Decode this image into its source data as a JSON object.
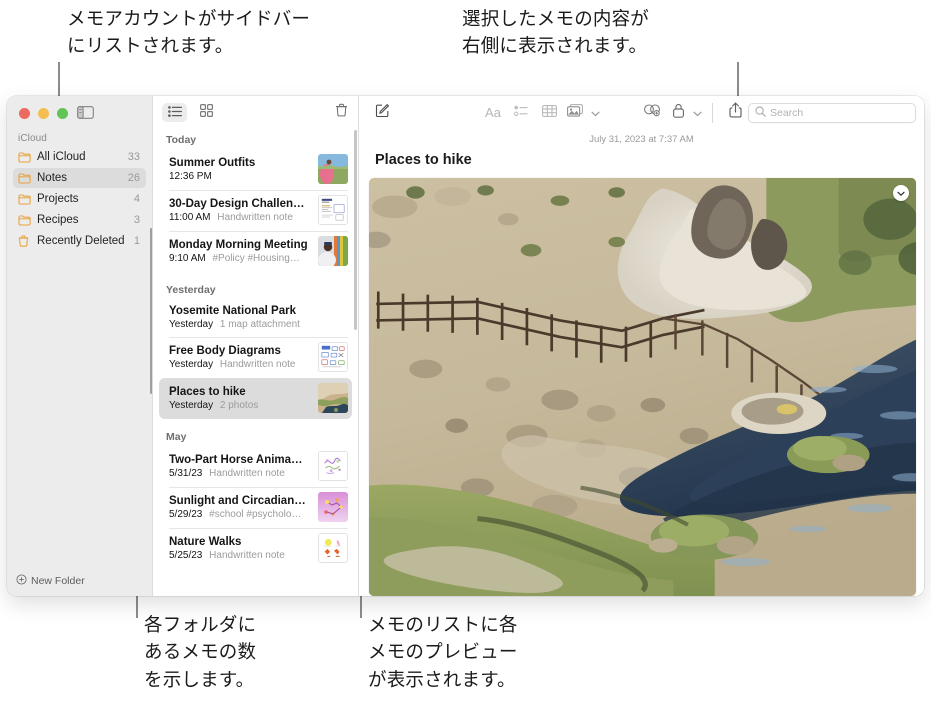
{
  "annotations": [
    {
      "id": "a1",
      "text": "メモアカウントがサイドバー\nにリストされます。"
    },
    {
      "id": "a2",
      "text": "選択したメモの内容が\n右側に表示されます。"
    },
    {
      "id": "a3",
      "text": "各フォルダに\nあるメモの数\nを示します。"
    },
    {
      "id": "a4",
      "text": "メモのリストに各\nメモのプレビュー\nが表示されます。"
    }
  ],
  "window": {
    "traffic_lights": [
      "close-red",
      "minimize-yellow",
      "zoom-green"
    ],
    "sidebar_toggle_icon": "sidebar-toggle-icon"
  },
  "sidebar": {
    "section_label": "iCloud",
    "items": [
      {
        "label": "All iCloud",
        "count": "33",
        "icon": "folder-icon",
        "selected": false
      },
      {
        "label": "Notes",
        "count": "26",
        "icon": "folder-icon",
        "selected": true
      },
      {
        "label": "Projects",
        "count": "4",
        "icon": "folder-icon",
        "selected": false
      },
      {
        "label": "Recipes",
        "count": "3",
        "icon": "folder-icon",
        "selected": false
      },
      {
        "label": "Recently Deleted",
        "count": "1",
        "icon": "trash-icon",
        "selected": false
      }
    ],
    "new_folder_label": "New Folder",
    "new_folder_icon": "plus-circle-icon"
  },
  "note_list": {
    "toolbar": {
      "list_view_icon": "list-view-icon",
      "gallery_view_icon": "gallery-view-icon",
      "delete_icon": "trash-icon",
      "active_view": "list"
    },
    "groups": [
      {
        "label": "Today",
        "notes": [
          {
            "title": "Summer Outfits",
            "time": "12:36 PM",
            "snippet": "",
            "thumb": "photo-pink-dress",
            "selected": false
          },
          {
            "title": "30-Day Design Challen…",
            "time": "11:00 AM",
            "snippet": "Handwritten note",
            "thumb": "scan-document",
            "selected": false
          },
          {
            "title": "Monday Morning Meeting",
            "time": "9:10 AM",
            "snippet": "#Policy #Housing…",
            "thumb": "photo-person-colors",
            "selected": false
          }
        ]
      },
      {
        "label": "Yesterday",
        "notes": [
          {
            "title": "Yosemite National Park",
            "time": "Yesterday",
            "snippet": "1 map attachment",
            "thumb": "",
            "selected": false
          },
          {
            "title": "Free Body Diagrams",
            "time": "Yesterday",
            "snippet": "Handwritten note",
            "thumb": "diagram-sketch",
            "selected": false
          },
          {
            "title": "Places to hike",
            "time": "Yesterday",
            "snippet": "2 photos",
            "thumb": "photo-hot-creek",
            "selected": true
          }
        ]
      },
      {
        "label": "May",
        "notes": [
          {
            "title": "Two-Part Horse Anima…",
            "time": "5/31/23",
            "snippet": "Handwritten note",
            "thumb": "sketch-purple",
            "selected": false
          },
          {
            "title": "Sunlight and Circadian…",
            "time": "5/29/23",
            "snippet": "#school #psycholo…",
            "thumb": "diagram-magenta",
            "selected": false
          },
          {
            "title": "Nature Walks",
            "time": "5/25/23",
            "snippet": "Handwritten note",
            "thumb": "sketch-flowers",
            "selected": false
          }
        ]
      }
    ]
  },
  "detail": {
    "toolbar": {
      "compose_icon": "compose-note-icon",
      "format_icon": "format-text-icon",
      "checklist_icon": "checklist-icon",
      "table_icon": "table-icon",
      "media_icon": "media-insert-icon",
      "media_chevron_icon": "chevron-down-icon",
      "collaborate_icon": "collaborate-icon",
      "lock_icon": "lock-icon",
      "lock_chevron_icon": "chevron-down-icon",
      "share_icon": "share-icon"
    },
    "search": {
      "placeholder": "Search",
      "icon": "search-icon",
      "value": ""
    },
    "date": "July 31, 2023 at 7:37 AM",
    "title": "Places to hike",
    "attachment": {
      "name": "hot-creek-photo",
      "menu_icon": "chevron-down-circle-icon"
    }
  },
  "colors": {
    "folder": "#E9A23B",
    "selection": "#DCDCDC",
    "sidebar_bg": "#ECECEC",
    "text": "#1B1B1B",
    "muted": "#9A9A9A"
  }
}
